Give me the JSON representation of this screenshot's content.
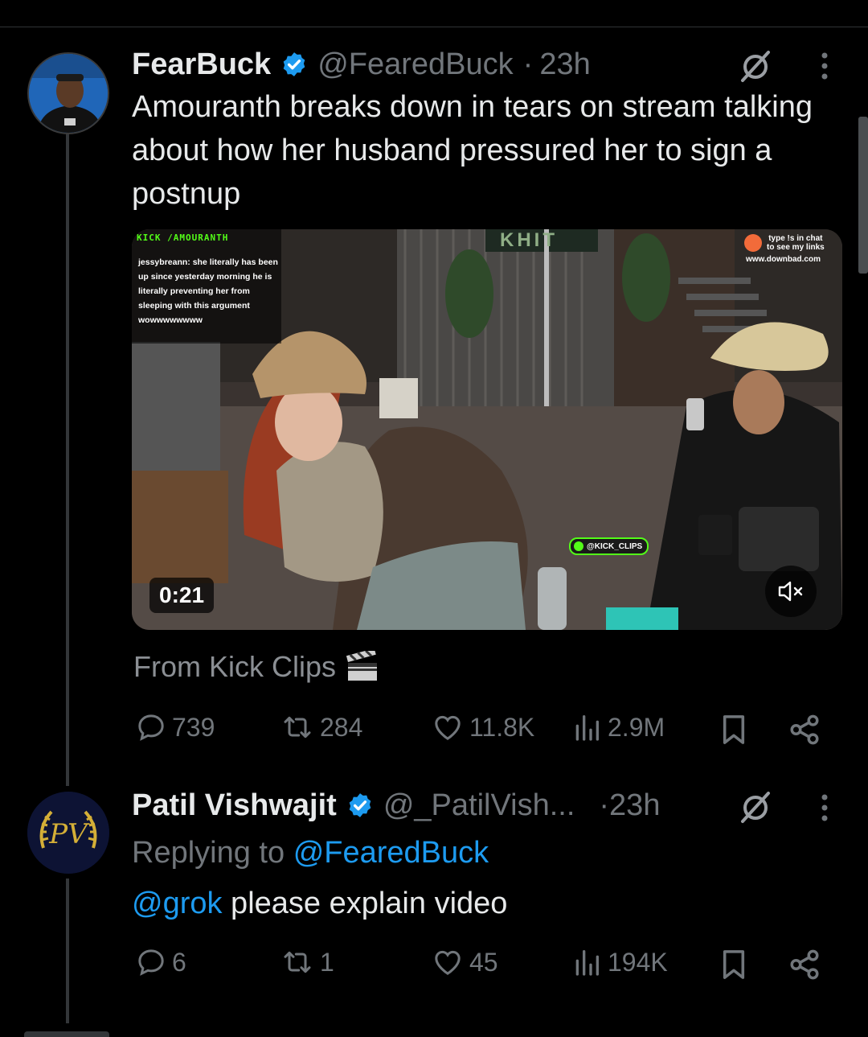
{
  "tweet": {
    "display_name": "FearBuck",
    "handle": "@FearedBuck",
    "separator": "·",
    "time": "23h",
    "text": "Amouranth breaks down in tears on stream talking about how her husband pressured her to sign a postnup",
    "video": {
      "overlay_brand": "KICK /AMOURANTH",
      "chat_message": "jessybreann: she literally has been up since yesterday morning he is literally preventing her from sleeping with this argument wowwwwwwww",
      "promo_line1": "type !s in chat",
      "promo_line2": "to see my links",
      "promo_url": "www.downbad.com",
      "watermark": "@KICK_CLIPS",
      "banner_text": "KHIT",
      "duration": "0:21",
      "mute_icon": "speaker-muted-icon"
    },
    "source_label": "From Kick Clips",
    "source_icon": "clapperboard-icon",
    "stats": {
      "replies": "739",
      "reposts": "284",
      "likes": "11.8K",
      "views": "2.9M"
    }
  },
  "reply": {
    "display_name": "Patil Vishwajit",
    "handle": "@_PatilVish...",
    "time": "·23h",
    "replying_prefix": "Replying to",
    "replying_to": "@FearedBuck",
    "mention": "@grok",
    "text": " please explain video",
    "avatar_monogram": "PV",
    "stats": {
      "replies": "6",
      "reposts": "1",
      "likes": "45",
      "views": "194K"
    }
  },
  "colors": {
    "background": "#000000",
    "accent": "#1d9bf0",
    "text": "#e7e9ea",
    "muted": "#71767b"
  }
}
